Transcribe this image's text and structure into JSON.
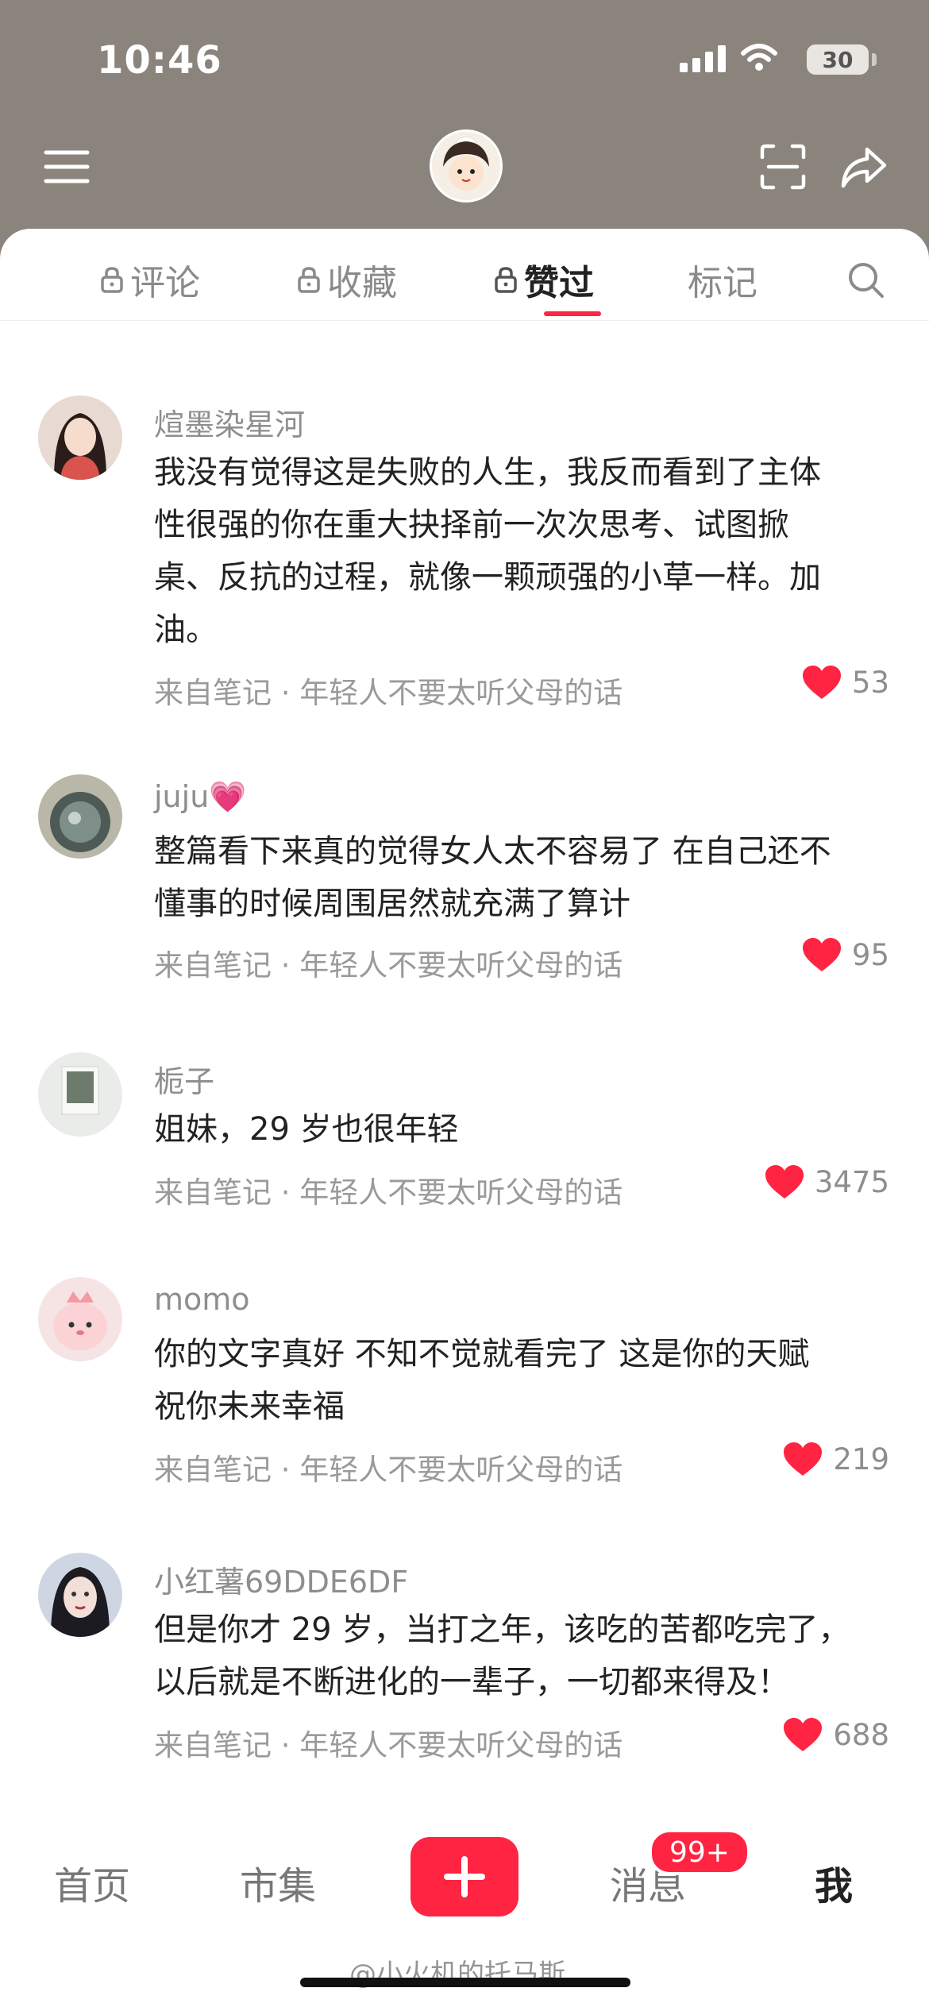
{
  "status": {
    "time": "10:46",
    "battery": "30"
  },
  "tabs": [
    {
      "label": "评论",
      "locked": true
    },
    {
      "label": "收藏",
      "locked": true
    },
    {
      "label": "赞过",
      "locked": true,
      "active": true
    },
    {
      "label": "标记",
      "locked": false
    }
  ],
  "comments": [
    {
      "name": "煊墨染星河",
      "lines": [
        "我没有觉得这是失败的人生，我反而看到了主体",
        "性很强的你在重大抉择前一次次思考、试图掀",
        "桌、反抗的过程，就像一颗顽强的小草一样。加",
        "油。"
      ],
      "meta": "来自笔记 · 年轻人不要太听父母的话",
      "likes": "53"
    },
    {
      "name": "juju💗",
      "lines": [
        "整篇看下来真的觉得女人太不容易了 在自己还不",
        "懂事的时候周围居然就充满了算计"
      ],
      "meta": "来自笔记 · 年轻人不要太听父母的话",
      "likes": "95"
    },
    {
      "name": "栀子",
      "lines": [
        "姐妹，29 岁也很年轻"
      ],
      "meta": "来自笔记 · 年轻人不要太听父母的话",
      "likes": "3475"
    },
    {
      "name": "momo",
      "lines": [
        "你的文字真好 不知不觉就看完了 这是你的天赋",
        "祝你未来幸福"
      ],
      "meta": "来自笔记 · 年轻人不要太听父母的话",
      "likes": "219"
    },
    {
      "name": "小红薯69DDE6DF",
      "lines": [
        "但是你才 29 岁，当打之年，该吃的苦都吃完了，",
        "以后就是不断进化的一辈子，一切都来得及！"
      ],
      "meta": "来自笔记 · 年轻人不要太听父母的话",
      "likes": "688"
    }
  ],
  "nav": {
    "home": "首页",
    "market": "市集",
    "messages": "消息",
    "me": "我",
    "badge": "99+"
  },
  "watermark": "@小火机的托马斯",
  "colors": {
    "accent": "#ff2442",
    "header_bg": "#8a847d"
  }
}
